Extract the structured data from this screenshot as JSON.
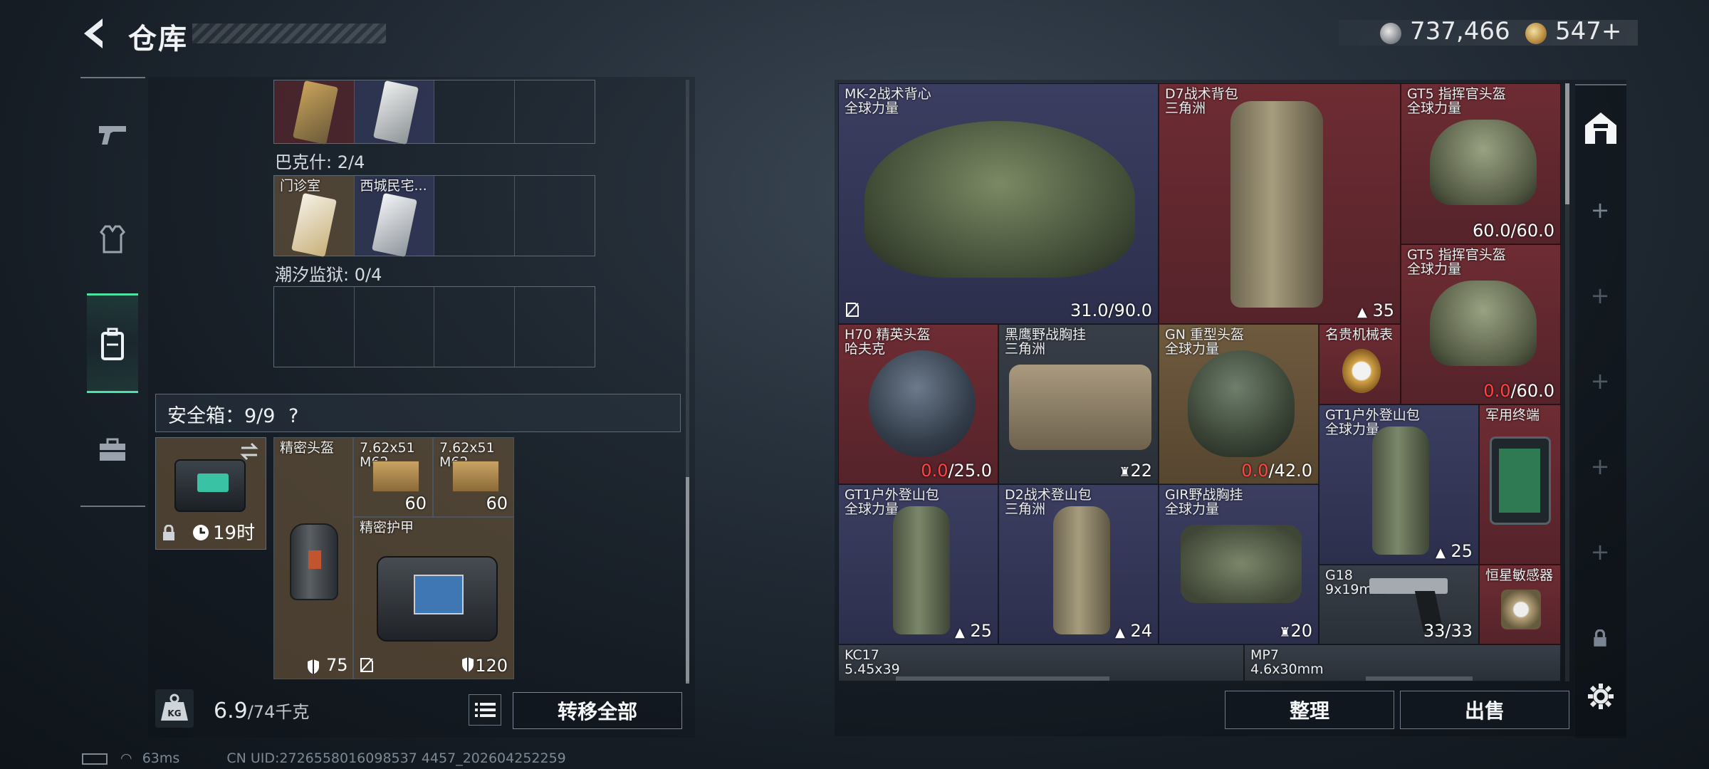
{
  "header": {
    "title": "仓库",
    "currency1": "737,466",
    "currency2": "547",
    "currency2_plus": "+"
  },
  "left": {
    "section1_items": [
      "",
      ""
    ],
    "section2_label": "巴克什: 2/4",
    "section2_items": [
      "门诊室",
      "西城民宅..."
    ],
    "section3_label": "潮汐监狱: 0/4",
    "safe_label": "安全箱：9/9",
    "safe_help": "?",
    "safe_box_timer": "19时",
    "items": [
      {
        "name": "精密头盔",
        "stat": "75"
      },
      {
        "name": "7.62x51\nM62",
        "count": "60"
      },
      {
        "name": "7.62x51\nM62",
        "count": "60"
      },
      {
        "name": "精密护甲",
        "stat": "120"
      }
    ],
    "weight_value": "6.9",
    "weight_suffix": "/74千克",
    "transfer_button": "转移全部"
  },
  "right": {
    "items": [
      {
        "name": "MK-2战术背心",
        "sub": "全球力量",
        "zero": "",
        "rest": "31.0/90.0",
        "icon": "no-repair-icon"
      },
      {
        "name": "D7战术背包",
        "sub": "三角洲",
        "count": "35",
        "icon": "backpack-icon"
      },
      {
        "name": "GT5 指挥官头盔",
        "sub": "全球力量",
        "zero": "",
        "rest": "60.0/60.0"
      },
      {
        "name": "GT5 指挥官头盔",
        "sub": "全球力量",
        "zero": "0.0",
        "rest": "/60.0"
      },
      {
        "name": "H70 精英头盔",
        "sub": "哈夫克",
        "zero": "0.0",
        "rest": "/25.0"
      },
      {
        "name": "黑鹰野战胸挂",
        "sub": "三角洲",
        "count": "22",
        "icon": "vest-icon"
      },
      {
        "name": "GN 重型头盔",
        "sub": "全球力量",
        "zero": "0.0",
        "rest": "/42.0"
      },
      {
        "name": "名贵机械表",
        "sub": ""
      },
      {
        "name": "GT1户外登山包",
        "sub": "全球力量",
        "count": "25",
        "icon": "backpack-icon"
      },
      {
        "name": "军用终端",
        "sub": ""
      },
      {
        "name": "GT1户外登山包",
        "sub": "全球力量",
        "count": "25",
        "icon": "backpack-icon"
      },
      {
        "name": "D2战术登山包",
        "sub": "三角洲",
        "count": "24",
        "icon": "backpack-icon"
      },
      {
        "name": "GIR野战胸挂",
        "sub": "全球力量",
        "count": "20",
        "icon": "vest-icon"
      },
      {
        "name": "G18",
        "sub": "9x19mm",
        "ammo": "33/33"
      },
      {
        "name": "恒星敏感器",
        "sub": ""
      },
      {
        "name": "KC17",
        "sub": "5.45x39"
      },
      {
        "name": "MP7",
        "sub": "4.6x30mm"
      }
    ],
    "sort_button": "整理",
    "sell_button": "出售"
  },
  "status": {
    "ping": "63ms",
    "uid": "CN UID:2726558016098537 4457_202604252259"
  }
}
